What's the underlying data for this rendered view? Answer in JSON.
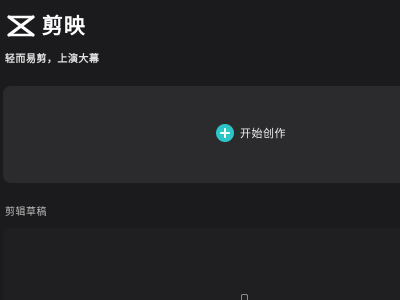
{
  "app": {
    "name": "剪映",
    "tagline": "轻而易剪，上演大幕",
    "logo_icon": "capcut-logo-icon"
  },
  "create": {
    "label": "开始创作",
    "icon": "plus-circle-icon",
    "accent_color": "#2cc5c8"
  },
  "drafts": {
    "title": "剪辑草稿"
  },
  "colors": {
    "background": "#1b1b1d",
    "card": "#2b2b2e"
  }
}
